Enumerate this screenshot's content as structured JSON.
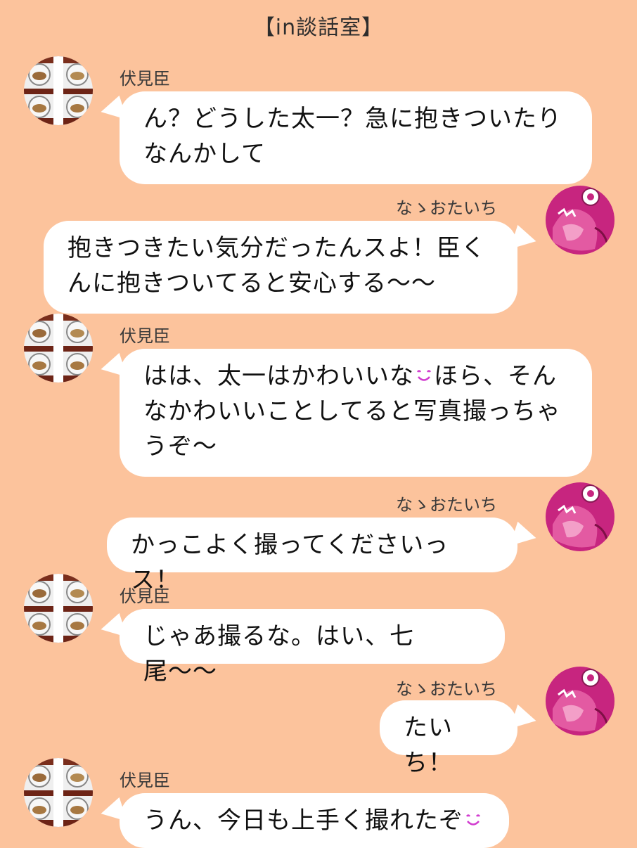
{
  "header": {
    "title": "【in談話室】"
  },
  "speakers": {
    "omi": {
      "name": "伏見臣",
      "avatar": "photographer-avatar-icon"
    },
    "taichi": {
      "name": "なゝおたいち",
      "avatar": "pink-monster-avatar-icon"
    }
  },
  "messages": [
    {
      "side": "left",
      "name": "伏見臣",
      "lines": [
        "ん？どうした太一？急に抱きついたり",
        "なんかして"
      ]
    },
    {
      "side": "right",
      "name": "なゝおたいち",
      "lines": [
        "抱きつきたい気分だったんスよ！臣く",
        "んに抱きついてると安心する〜〜"
      ]
    },
    {
      "side": "left",
      "name": "伏見臣",
      "lines": [
        "はは、太一はかわいいな",
        "ほら、そん",
        "なかわいいことしてると写真撮っちゃ",
        "うぞ〜"
      ]
    },
    {
      "side": "right",
      "name": "なゝおたいち",
      "lines": [
        "かっこよく撮ってくださいっス！"
      ]
    },
    {
      "side": "left",
      "name": "伏見臣",
      "lines": [
        "じゃあ撮るな。はい、七尾〜〜"
      ]
    },
    {
      "side": "right",
      "name": "なゝおたいち",
      "lines": [
        "たいち！"
      ]
    },
    {
      "side": "left",
      "name": "伏見臣",
      "lines": [
        "うん、今日も上手く撮れたぞ"
      ]
    }
  ],
  "colors": {
    "background": "#fcc39c",
    "bubble": "#ffffff",
    "emoji": "#d13ccf"
  }
}
